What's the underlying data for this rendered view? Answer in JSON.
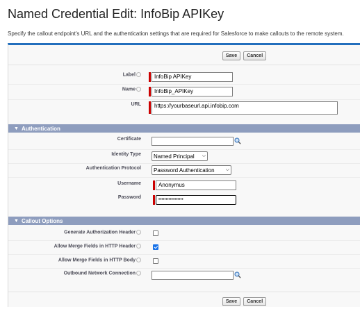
{
  "page": {
    "title": "Named Credential Edit: InfoBip APIKey",
    "subtitle": "Specify the callout endpoint's URL and the authentication settings that are required for Salesforce to make callouts to the remote system."
  },
  "buttons": {
    "save": "Save",
    "cancel": "Cancel"
  },
  "fields": {
    "label": {
      "label": "Label",
      "value": "InfoBip APIKey"
    },
    "name": {
      "label": "Name",
      "value": "InfoBip_APIKey"
    },
    "url": {
      "label": "URL",
      "value": "https://yourbaseurl.api.infobip.com"
    }
  },
  "authentication": {
    "header": "Authentication",
    "certificate": {
      "label": "Certificate",
      "value": ""
    },
    "identity_type": {
      "label": "Identity Type",
      "value": "Named Principal"
    },
    "auth_protocol": {
      "label": "Authentication Protocol",
      "value": "Password Authentication"
    },
    "username": {
      "label": "Username",
      "value": "Anonymus"
    },
    "password": {
      "label": "Password",
      "value": "•••••••••••••••••"
    }
  },
  "callout_options": {
    "header": "Callout Options",
    "gen_auth_header": {
      "label": "Generate Authorization Header",
      "checked": false
    },
    "merge_header": {
      "label": "Allow Merge Fields in HTTP Header",
      "checked": true
    },
    "merge_body": {
      "label": "Allow Merge Fields in HTTP Body",
      "checked": false
    },
    "outbound": {
      "label": "Outbound Network Connection",
      "value": ""
    }
  },
  "colors": {
    "accent": "#236fbd",
    "section": "#8e9dbe",
    "required": "#cc0000"
  }
}
